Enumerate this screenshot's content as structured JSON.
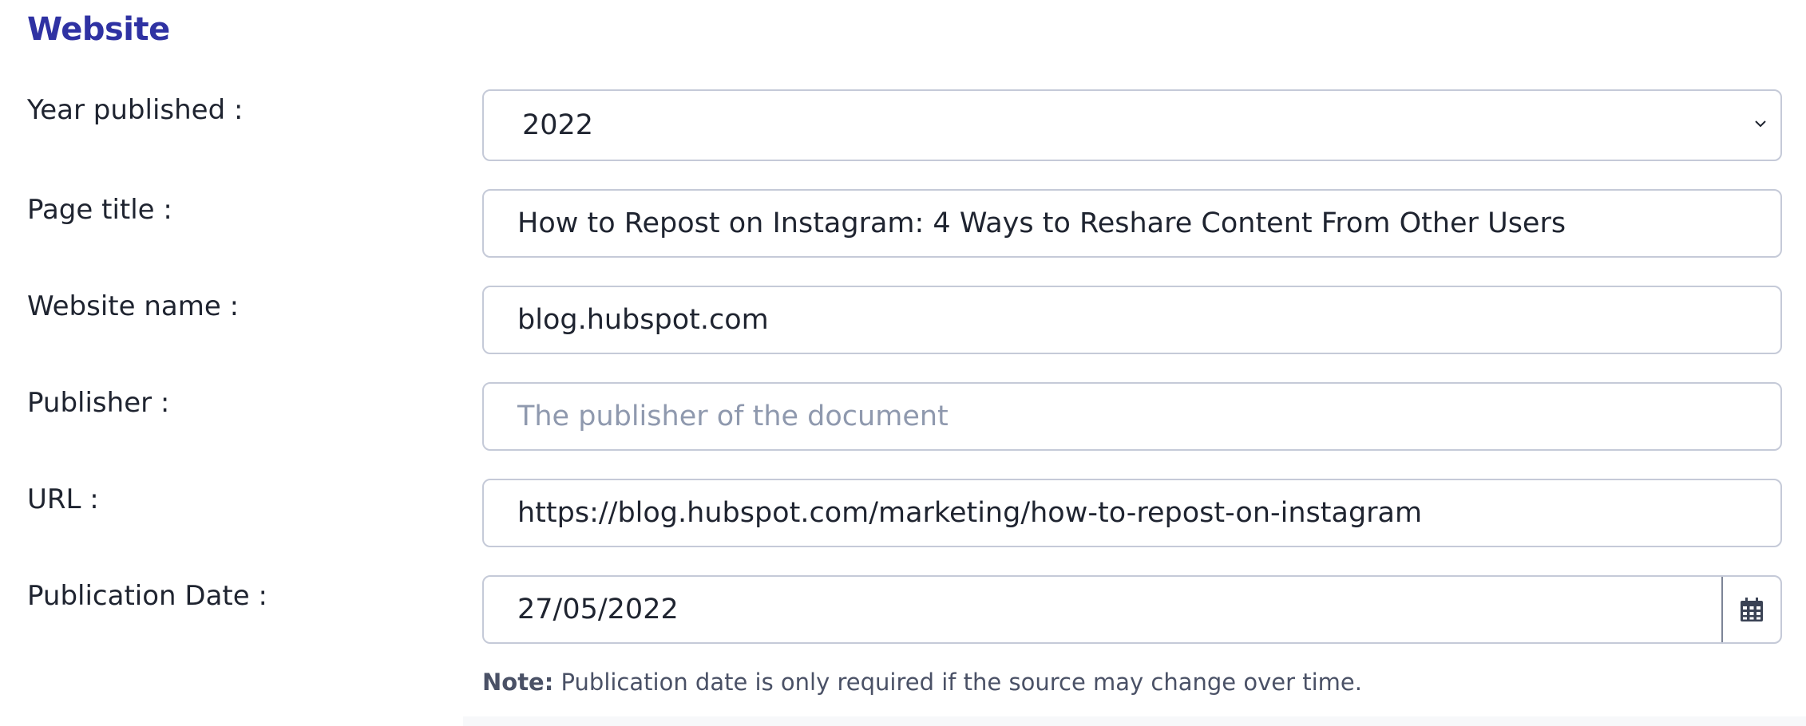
{
  "section": {
    "title": "Website"
  },
  "fields": {
    "year": {
      "label": "Year published :",
      "value": "2022"
    },
    "page_title": {
      "label": "Page title :",
      "value": "How to Repost on Instagram: 4 Ways to Reshare Content From Other Users"
    },
    "website_name": {
      "label": "Website name :",
      "value": "blog.hubspot.com"
    },
    "publisher": {
      "label": "Publisher :",
      "value": "",
      "placeholder": "The publisher of the document"
    },
    "url": {
      "label": "URL :",
      "value": "https://blog.hubspot.com/marketing/how-to-repost-on-instagram"
    },
    "publication_date": {
      "label": "Publication Date :",
      "value": "27/05/2022"
    }
  },
  "note": {
    "bold": "Note:",
    "text": "Publication date is only required if the source may change over time."
  },
  "icons": {
    "year_dropdown": "chevron-down-icon",
    "date_picker": "calendar-icon"
  },
  "colors": {
    "section_title": "#2f32a3",
    "border": "#c5cad8",
    "placeholder": "#8f99ae",
    "text": "#1f2430"
  }
}
